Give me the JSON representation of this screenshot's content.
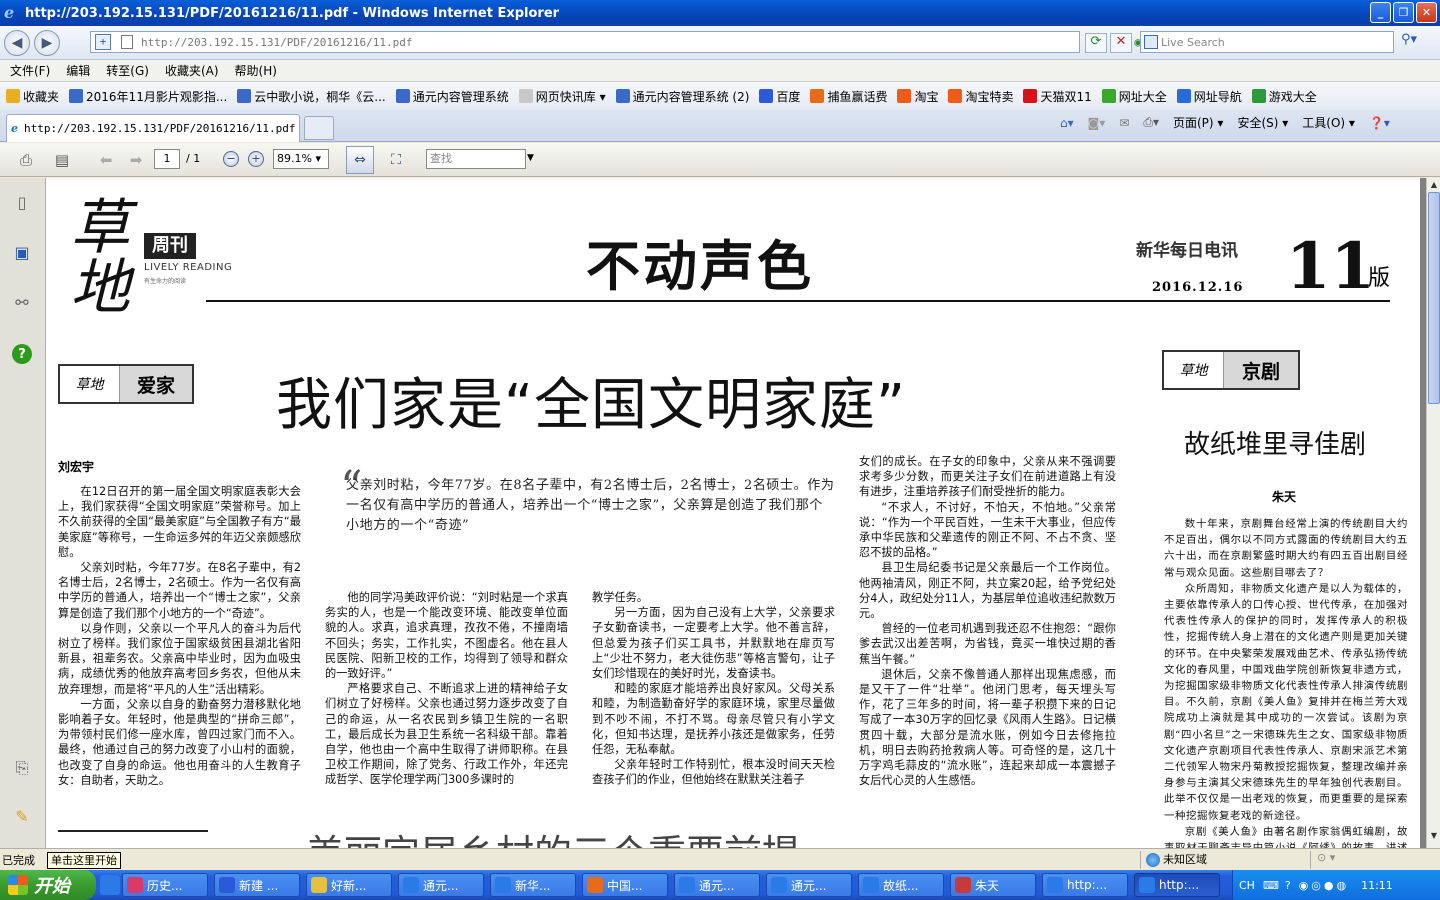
{
  "window": {
    "title": "http://203.192.15.131/PDF/20161216/11.pdf - Windows Internet Explorer",
    "buttons": [
      "_",
      "❐",
      "✕"
    ]
  },
  "address_bar": {
    "url": "http://203.192.15.131/PDF/20161216/11.pdf",
    "search_placeholder": "Live Search"
  },
  "menu": [
    "文件(F)",
    "编辑",
    "转至(G)",
    "收藏夹(A)",
    "帮助(H)"
  ],
  "favorites": [
    {
      "label": "收藏夹",
      "color": "#e8b020"
    },
    {
      "label": "2016年11月影片观影指...",
      "color": "#3a6ac8"
    },
    {
      "label": "云中歌小说，桐华《云...",
      "color": "#3a6ac8"
    },
    {
      "label": "通元内容管理系统",
      "color": "#3a6ac8"
    },
    {
      "label": "网页快讯库 ▾",
      "color": "#c8c8c8"
    },
    {
      "label": "通元内容管理系统 (2)",
      "color": "#3a6ac8"
    },
    {
      "label": "百度",
      "color": "#2a5ad8"
    },
    {
      "label": "捕鱼赢话费",
      "color": "#e86a1a"
    },
    {
      "label": "淘宝",
      "color": "#f25a1a"
    },
    {
      "label": "淘宝特卖",
      "color": "#f25a1a"
    },
    {
      "label": "天猫双11",
      "color": "#d8101a"
    },
    {
      "label": "网址大全",
      "color": "#3aa82a"
    },
    {
      "label": "网址导航",
      "color": "#2a6ad8"
    },
    {
      "label": "游戏大全",
      "color": "#2a9a3a"
    }
  ],
  "tab": {
    "label": "http://203.192.15.131/PDF/20161216/11.pdf"
  },
  "commands": [
    "页面(P) ▾",
    "安全(S) ▾",
    "工具(O) ▾"
  ],
  "pdf_toolbar": {
    "page": "1",
    "page_total": "/ 1",
    "zoom": "89.1%",
    "find_placeholder": "查找"
  },
  "newspaper": {
    "logo_text": "草地",
    "weekly": "周刊",
    "lively": "LIVELY READING",
    "lively_sub": "有生命力的阅读",
    "masthead": "不动声色",
    "agency": "新华每日电讯",
    "date": "2016.12.16",
    "page_number": "11",
    "page_suffix": "版",
    "section_left_logo": "草地",
    "section_left": "爱家",
    "section_right_logo": "草地",
    "section_right": "京剧",
    "headline": "我们家是“全国文明家庭”",
    "author1": "刘宏宇",
    "col1": [
      "在12日召开的第一届全国文明家庭表彰大会上，我们家获得“全国文明家庭”荣誉称号。加上不久前获得的全国“最美家庭”与全国教子有方“最美家庭”等称号，一生命运多舛的年迈父亲颇感欣慰。",
      "父亲刘时粘，今年77岁。在8名子辈中，有2名博士后，2名博士，2名硕士。作为一名仅有高中学历的普通人，培养出一个“博士之家”，父亲算是创造了我们那个小地方的一个“奇迹”。",
      "以身作则，父亲以一个平凡人的奋斗为后代树立了榜样。我们家位于国家级贫困县湖北省阳新县，祖辈务农。父亲高中毕业时，因为血吸虫病，成绩优秀的他放弃高考回乡务农，但他从未放弃理想，而是将“平凡的人生”活出精彩。",
      "一方面，父亲以自身的勤奋努力潜移默化地影响着子女。年轻时，他是典型的“拼命三郎”，为带领村民们修一座水库，曾四过家门而不入。最终，他通过自己的努力改变了小山村的面貌，也改变了自身的命运。他也用奋斗的人生教育子女：自助者，天助之。"
    ],
    "quote": "父亲刘时粘，今年77岁。在8名子辈中，有2名博士后，2名博士，2名硕士。作为一名仅有高中学历的普通人，培养出一个“博士之家”，父亲算是创造了我们那个小地方的一个“奇迹”",
    "col2": [
      "他的同学冯美政评价说：“刘时粘是一个求真务实的人，也是一个能改变环境、能改变单位面貌的人。求真，追求真理，孜孜不倦，不撞南墙不回头；务实，工作扎实，不图虚名。他在县人民医院、阳新卫校的工作，均得到了领导和群众的一致好评。”",
      "严格要求自己、不断追求上进的精神给子女们树立了好榜样。父亲也通过努力逐步改变了自己的命运，从一名农民到乡镇卫生院的一名职工，最后成长为县卫生系统一名科级干部。靠着自学，他也由一个高中生取得了讲师职称。在县卫校工作期间，除了党务、行政工作外，年还完成哲学、医学伦理学两门300多课时的"
    ],
    "col3": [
      "教学任务。",
      "另一方面，因为自己没有上大学，父亲要求子女勤奋读书，一定要考上大学。他不善言辞，但总爱为孩子们买工具书，并默默地在扉页写上“少壮不努力，老大徒伤悲”等格言警句，让子女们珍惜现在的美好时光，发奋读书。",
      "和睦的家庭才能培养出良好家风。父母关系和睦，为制造勤奋好学的家庭环境，家里尽量做到不吵不闹，不打不骂。母亲尽管只有小学文化，但知书达理，是抚养小孩还是做家务，任劳任怨，无私奉献。",
      "父亲年轻时工作特别忙，根本没时间天天检查孩子们的作业，但他始终在默默关注着子"
    ],
    "col4": [
      "女们的成长。在子女的印象中，父亲从来不强调要求考多少分数，而更关注子女们在前进道路上有没有进步，注重培养孩子们耐受挫折的能力。",
      "“不求人，不讨好，不怕天，不怕地。”父亲常说：“作为一个平民百姓，一生未干大事业，但应传承中华民族和父辈遗传的刚正不阿、不占不贪、坚忍不拔的品格。”",
      "县卫生局纪委书记是父亲最后一个工作岗位。他两袖清风，刚正不阿，共立案20起，给予党纪处分4人，政纪处分11人，为基层单位追收违纪款数万元。",
      "曾经的一位老司机遇到我还忍不住抱怨：“跟你爹去武汉出差苦啊，为省钱，竟买一堆快过期的香蕉当午餐。”",
      "退休后，父亲不像普通人那样出现焦虑感，而是又干了一件“壮举”。他闭门思考，每天埋头写作，花了三年多的时间，将一辈子积攒下来的日记写成了一本30万字的回忆录《风雨人生路》。日记横贯四十载，大部分是流水账，例如今日去修拖拉机，明日去购药抢救病人等。可奇怪的是，这几十万字鸡毛蒜皮的“流水账”，连起来却成一本震撼子女后代心灵的人生感悟。"
    ],
    "subhead_right": "故纸堆里寻佳剧",
    "author2": "朱天",
    "rcol": [
      "数十年来，京剧舞台经常上演的传统剧目大约不足百出，偶尔以不同方式露面的传统剧目大约五六十出，而在京剧繁盛时期大约有四五百出剧目经常与观众见面。这些剧目哪去了？",
      "众所周知，非物质文化遗产是以人为载体的，主要依靠传承人的口传心授、世代传承，在加强对代表性传承人的保护的同时，发挥传承人的积极性，挖掘传统人身上潜在的文化遗产则是更加关键的环节。在中央繁荣发展戏曲艺术、传承弘扬传统文化的春风里，中国戏曲学院创新恢复非遗方式，为挖掘国家级非物质文化代表性传承人排演传统剧目。不久前，京剧《美人鱼》复排并在梅兰芳大戏院成功上演就是其中成功的一次尝试。该剧为京剧“四小名旦”之一宋德珠先生之女、国家级非物质文化遗产京剧项目代表性传承人、京剧宋派艺术第二代领军人物宋丹菊教授挖掘恢复，整理改编并亲身参与主演其父宋德珠先生的早年独创代表剧目。此举不仅仅是一出老戏的恢复，而更重要的是探索一种挖掘恢复老戏的新途径。",
      "京剧《美人鱼》由著名剧作家翁偶虹编剧，故事取材于聊斋志异中篇小说《阿绣》的故事，讲述了"
    ],
    "bottom_headline": "美丽宜居乡村的三个重要前提"
  },
  "status": {
    "done": "已完成",
    "tooltip": "单击这里开始",
    "zone": "未知区域"
  },
  "taskbar": {
    "start": "开始",
    "buttons": [
      {
        "label": "历史...",
        "color": "#d83a6a"
      },
      {
        "label": "新建 ...",
        "color": "#2a5ad8"
      },
      {
        "label": "好新...",
        "color": "#e8c040"
      },
      {
        "label": "通元...",
        "color": "#2a7ae8"
      },
      {
        "label": "新华...",
        "color": "#2a7ae8"
      },
      {
        "label": "中国...",
        "color": "#e86a1a"
      },
      {
        "label": "通元...",
        "color": "#2a7ae8"
      },
      {
        "label": "通元...",
        "color": "#2a7ae8"
      },
      {
        "label": "故纸...",
        "color": "#2a7ae8"
      },
      {
        "label": "朱天",
        "color": "#c83a3a"
      },
      {
        "label": "http:...",
        "color": "#2a7ae8"
      },
      {
        "label": "http:...",
        "color": "#2a7ae8"
      }
    ],
    "tray_lang": "CH",
    "clock": "11:11"
  }
}
